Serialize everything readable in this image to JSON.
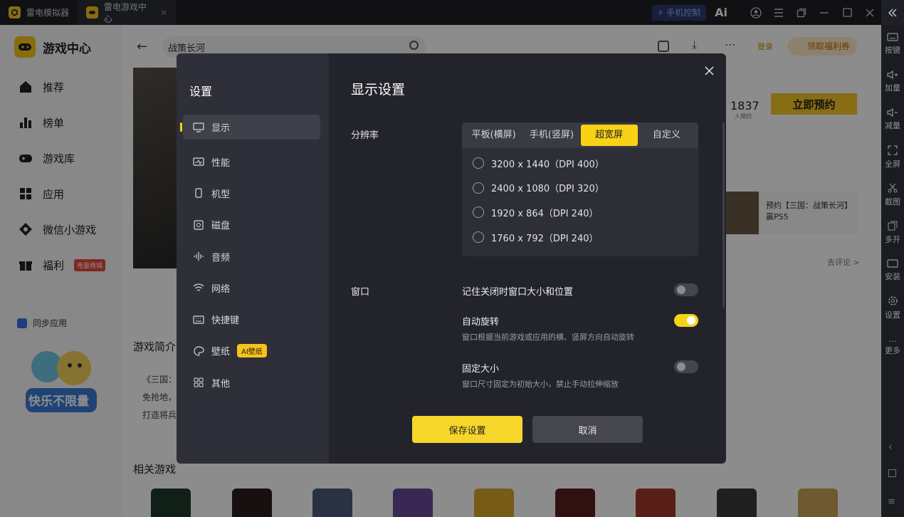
{
  "titlebar": {
    "tabs": [
      {
        "label": "雷电模拟器"
      },
      {
        "label": "雷电游戏中心"
      }
    ],
    "phone_control": "手机控制",
    "ai_logo": "Ai"
  },
  "right_toolbar": {
    "items": [
      {
        "label": "按键",
        "icon": "keyboard-icon"
      },
      {
        "label": "加量",
        "icon": "volume-up-icon"
      },
      {
        "label": "减量",
        "icon": "volume-down-icon"
      },
      {
        "label": "全屏",
        "icon": "fullscreen-icon"
      },
      {
        "label": "截图",
        "icon": "scissors-icon"
      },
      {
        "label": "多开",
        "icon": "multi-open-icon"
      },
      {
        "label": "安装",
        "icon": "apk-icon"
      },
      {
        "label": "设置",
        "icon": "gear-icon"
      },
      {
        "label": "更多",
        "icon": "more-icon"
      }
    ]
  },
  "sidebar": {
    "brand": "游戏中心",
    "items": [
      {
        "label": "推荐",
        "icon": "home-icon"
      },
      {
        "label": "榜单",
        "icon": "chart-icon"
      },
      {
        "label": "游戏库",
        "icon": "gamepad-icon"
      },
      {
        "label": "应用",
        "icon": "apps-icon"
      },
      {
        "label": "微信小游戏",
        "icon": "diamond-icon"
      },
      {
        "label": "福利",
        "icon": "gift-icon",
        "badge": "电量商城"
      }
    ],
    "sync_app": "同步应用",
    "promo_text": "快乐不限量"
  },
  "main": {
    "search_value": "战策长河",
    "login": "登录",
    "coupon": "领取福利券",
    "reserve_count": "1837",
    "reserve_sub": "人预约",
    "reserve_button": "立即预约",
    "news_text": "预约【三国：战策长河】赢PS5",
    "go_comment": "去评论 >",
    "intro_title": "游戏简介",
    "intro_lines": [
      "《三国：",
      "免抢地，",
      "打造将兵"
    ],
    "related_title": "相关游戏"
  },
  "dialog": {
    "side_title": "设置",
    "menu": [
      {
        "label": "显示",
        "icon": "monitor-icon",
        "selected": true
      },
      {
        "label": "性能",
        "icon": "performance-icon"
      },
      {
        "label": "机型",
        "icon": "phone-icon"
      },
      {
        "label": "磁盘",
        "icon": "disk-icon"
      },
      {
        "label": "音频",
        "icon": "audio-icon"
      },
      {
        "label": "网络",
        "icon": "wifi-icon"
      },
      {
        "label": "快捷键",
        "icon": "keyboard-icon"
      },
      {
        "label": "壁纸",
        "icon": "palette-icon",
        "badge": "AI壁纸"
      },
      {
        "label": "其他",
        "icon": "grid-icon"
      }
    ],
    "title": "显示设置",
    "resolution": {
      "label": "分辨率",
      "tabs": [
        "平板(横屏)",
        "手机(竖屏)",
        "超宽屏",
        "自定义"
      ],
      "active_tab": "超宽屏",
      "options": [
        "3200 x 1440（DPI 400）",
        "2400 x 1080（DPI 320）",
        "1920 x 864（DPI 240）",
        "1760 x 792（DPI 240）"
      ]
    },
    "window": {
      "label": "窗口",
      "remember": {
        "title": "记住关闭时窗口大小和位置",
        "on": false
      },
      "auto_rotate": {
        "title": "自动旋转",
        "desc": "窗口根据当前游戏或应用的横、竖屏方向自动旋转",
        "on": true
      },
      "fixed_size": {
        "title": "固定大小",
        "desc": "窗口尺寸固定为初始大小，禁止手动拉伸缩放",
        "on": false
      }
    },
    "save_button": "保存设置",
    "cancel_button": "取消"
  },
  "colors": {
    "accent": "#F7D117",
    "dialog_bg": "#23242B",
    "dialog_side": "#2E2F38"
  }
}
